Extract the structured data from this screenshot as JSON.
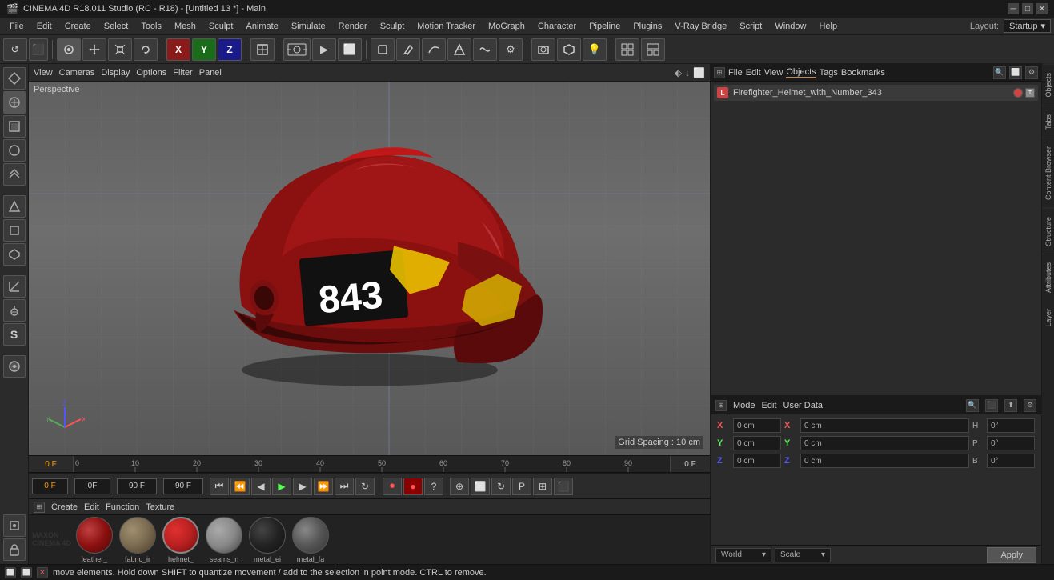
{
  "titleBar": {
    "title": "CINEMA 4D R18.011 Studio (RC - R18) - [Untitled 13 *] - Main",
    "controls": [
      "─",
      "□",
      "✕"
    ]
  },
  "menuBar": {
    "items": [
      "File",
      "Edit",
      "Create",
      "Select",
      "Tools",
      "Mesh",
      "Sculpt",
      "Animate",
      "Simulate",
      "Render",
      "Sculpt",
      "Motion Tracker",
      "MoGraph",
      "Character",
      "Pipeline",
      "Plugins",
      "V-Ray Bridge",
      "Script",
      "Window",
      "Help"
    ]
  },
  "toolbar": {
    "undo_label": "↺",
    "layout_label": "Startup"
  },
  "viewport": {
    "perspective_label": "Perspective",
    "grid_spacing": "Grid Spacing : 10 cm",
    "header_tabs": [
      "View",
      "Cameras",
      "Display",
      "Options",
      "Filter",
      "Panel"
    ]
  },
  "timeline": {
    "start_frame": "0 F",
    "current_frame": "0 F",
    "end_frame": "90 F",
    "current_time": "0 F",
    "markers": [
      0,
      10,
      20,
      30,
      40,
      50,
      60,
      70,
      80,
      90
    ]
  },
  "materials": {
    "header_tabs": [
      "Create",
      "Edit",
      "Function",
      "Texture"
    ],
    "items": [
      {
        "name": "leather_",
        "color": "#8B2020",
        "type": "matte"
      },
      {
        "name": "fabric_ir",
        "color": "#7a6a50",
        "type": "fabric"
      },
      {
        "name": "helmet_",
        "color": "#B82020",
        "type": "shiny"
      },
      {
        "name": "seams_n",
        "color": "#888888",
        "type": "metal"
      },
      {
        "name": "metal_ei",
        "color": "#222222",
        "type": "dark"
      },
      {
        "name": "metal_fa",
        "color": "#555555",
        "type": "grey"
      }
    ]
  },
  "objectsPanel": {
    "tabs": [
      "File",
      "Edit",
      "View",
      "Objects",
      "Tags",
      "Bookmarks"
    ],
    "search_placeholder": "Search...",
    "objects": [
      {
        "name": "Firefighter_Helmet_with_Number_343",
        "icon": "L",
        "tag_color": "#cc4444"
      }
    ]
  },
  "attributesPanel": {
    "tabs": [
      "Mode",
      "Edit",
      "User Data"
    ],
    "coords": {
      "x_pos": "0 cm",
      "y_pos": "0 cm",
      "z_pos": "0 cm",
      "x_rot": "0°",
      "y_rot": "0°",
      "z_rot": "0°",
      "x_scale": "0 cm",
      "y_scale": "0 cm",
      "z_scale": "0 cm",
      "h_val": "0°",
      "p_val": "0°",
      "b_val": "0°"
    },
    "coord_mode": "World",
    "scale_mode": "Scale",
    "apply_label": "Apply"
  },
  "statusBar": {
    "message": "move elements. Hold down SHIFT to quantize movement / add to the selection in point mode. CTRL to remove."
  },
  "rightSidebarTabs": [
    "Objects",
    "Tabs",
    "Content Browser",
    "Structure",
    "Attributes",
    "Layer"
  ]
}
